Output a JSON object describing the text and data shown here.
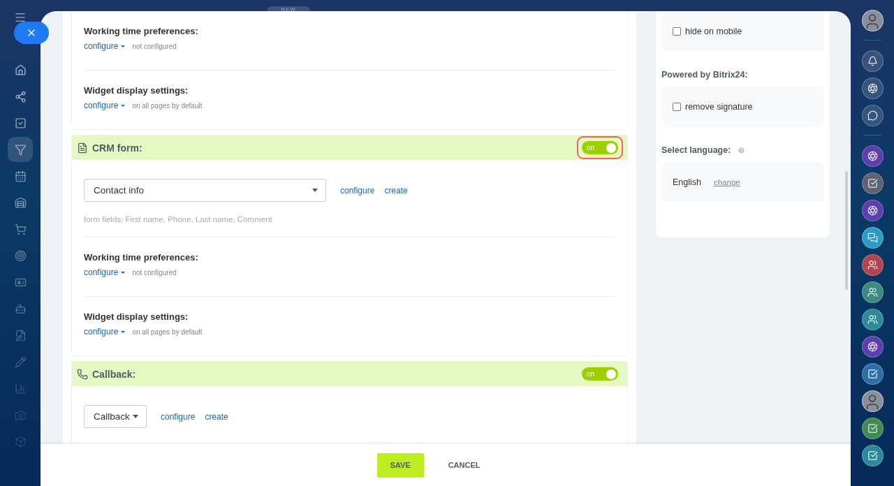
{
  "top_badge": "NEW",
  "left_nav": {
    "items": [
      {
        "selected": false
      },
      {
        "selected": false
      },
      {
        "selected": false
      },
      {
        "selected": true
      },
      {
        "selected": false
      },
      {
        "selected": false
      },
      {
        "selected": false
      },
      {
        "selected": false
      },
      {
        "selected": false
      },
      {
        "selected": false
      },
      {
        "selected": false
      },
      {
        "selected": false
      },
      {
        "selected": false
      },
      {
        "selected": false
      },
      {
        "selected": false
      }
    ]
  },
  "sections": [
    {
      "kind": "plain",
      "settings": [
        {
          "title": "Working time preferences:",
          "link": "configure",
          "note": "not configured"
        },
        {
          "title": "Widget display settings:",
          "link": "configure",
          "note": "on all pages by default"
        }
      ]
    },
    {
      "kind": "form_channel",
      "title": "CRM form:",
      "toggle": {
        "label": "on",
        "on": true,
        "highlighted": true
      },
      "select": {
        "value": "Contact info"
      },
      "links": [
        "configure",
        "create"
      ],
      "hint": "form fields: First name, Phone, Last name, Comment",
      "settings": [
        {
          "title": "Working time preferences:",
          "link": "configure",
          "note": "not configured"
        },
        {
          "title": "Widget display settings:",
          "link": "configure",
          "note": "on all pages by default"
        }
      ]
    },
    {
      "kind": "callback_channel",
      "title": "Callback:",
      "toggle": {
        "label": "on",
        "on": true,
        "highlighted": false
      },
      "select": {
        "value": "Callback"
      },
      "links": [
        "configure",
        "create"
      ]
    }
  ],
  "side": [
    {
      "kind": "checkbox",
      "label": "hide on mobile",
      "checked": false
    },
    {
      "kind": "heading",
      "label": "Powered by Bitrix24:"
    },
    {
      "kind": "checkbox",
      "label": "remove signature",
      "checked": false
    },
    {
      "kind": "heading_help",
      "label": "Select language:"
    },
    {
      "kind": "language",
      "value": "English",
      "link": "change"
    }
  ],
  "footer": {
    "buttons": [
      {
        "label": "SAVE",
        "primary": true
      },
      {
        "label": "CANCEL",
        "primary": false
      }
    ]
  },
  "right_bar": [
    {
      "kind": "avatar"
    },
    {
      "kind": "divider"
    },
    {
      "kind": "bell"
    },
    {
      "kind": "target"
    },
    {
      "kind": "chat"
    },
    {
      "kind": "divider"
    },
    {
      "kind": "app",
      "color": "#5b3fae"
    },
    {
      "kind": "task",
      "color": "#5d6372"
    },
    {
      "kind": "app",
      "color": "#5b3fae"
    },
    {
      "kind": "messages",
      "color": "#2c9bc7"
    },
    {
      "kind": "group",
      "color": "#b0464f"
    },
    {
      "kind": "group",
      "color": "#3c8a80"
    },
    {
      "kind": "group",
      "color": "#2d8a96"
    },
    {
      "kind": "app",
      "color": "#5b3fae"
    },
    {
      "kind": "task",
      "color": "#2f6fa8"
    },
    {
      "kind": "avatar"
    },
    {
      "kind": "task",
      "color": "#3f8a55"
    },
    {
      "kind": "task",
      "color": "#2a8a9a"
    }
  ]
}
